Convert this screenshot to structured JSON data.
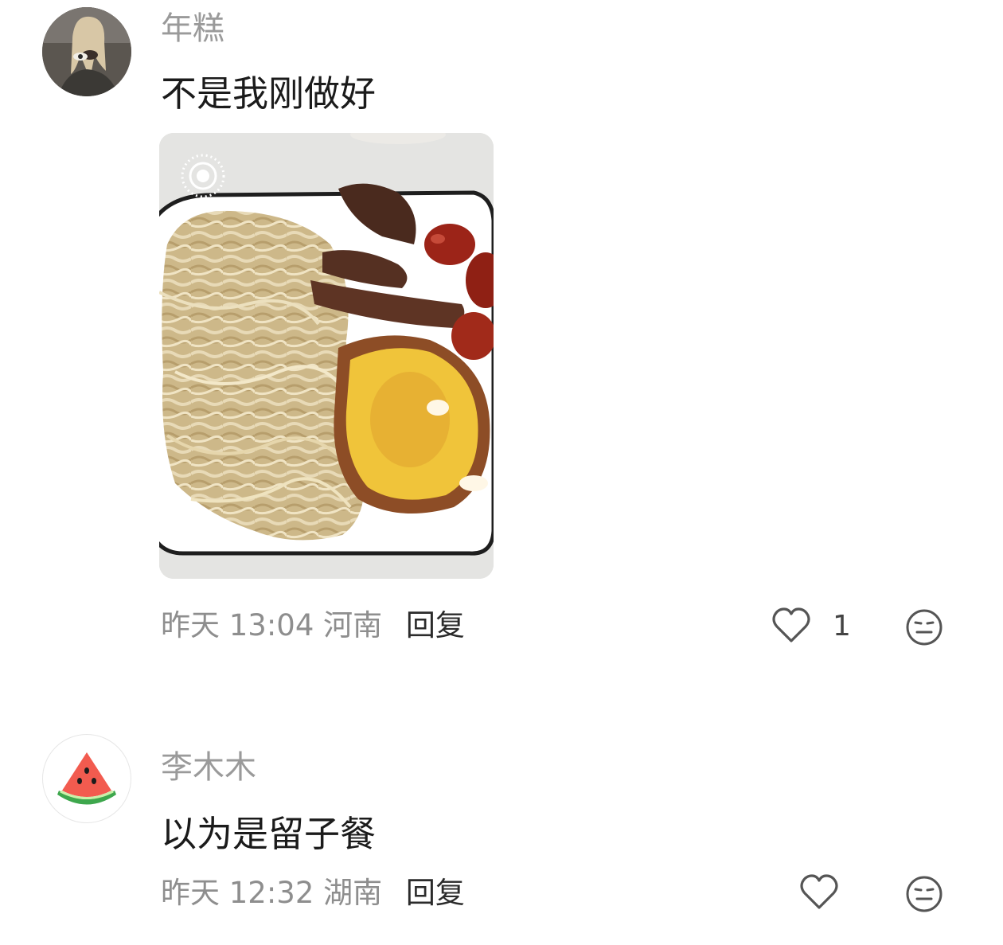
{
  "comments": [
    {
      "username": "年糕",
      "text": "不是我刚做好",
      "time": "昨天 13:04",
      "location": "河南",
      "reply_label": "回复",
      "like_count": "1",
      "has_image": true
    },
    {
      "username": "李木木",
      "text": "以为是留子餐",
      "time": "昨天 12:32",
      "location": "湖南",
      "reply_label": "回复",
      "like_count": "",
      "has_image": false
    }
  ],
  "icons": {
    "like": "heart-outline-icon",
    "reaction": "neutral-face-icon",
    "live_photo": "live-photo-icon"
  },
  "colors": {
    "meta_text": "#8e8e8e",
    "username": "#9a9a9a",
    "body_text": "#1b1b1b",
    "icon": "#555555"
  }
}
